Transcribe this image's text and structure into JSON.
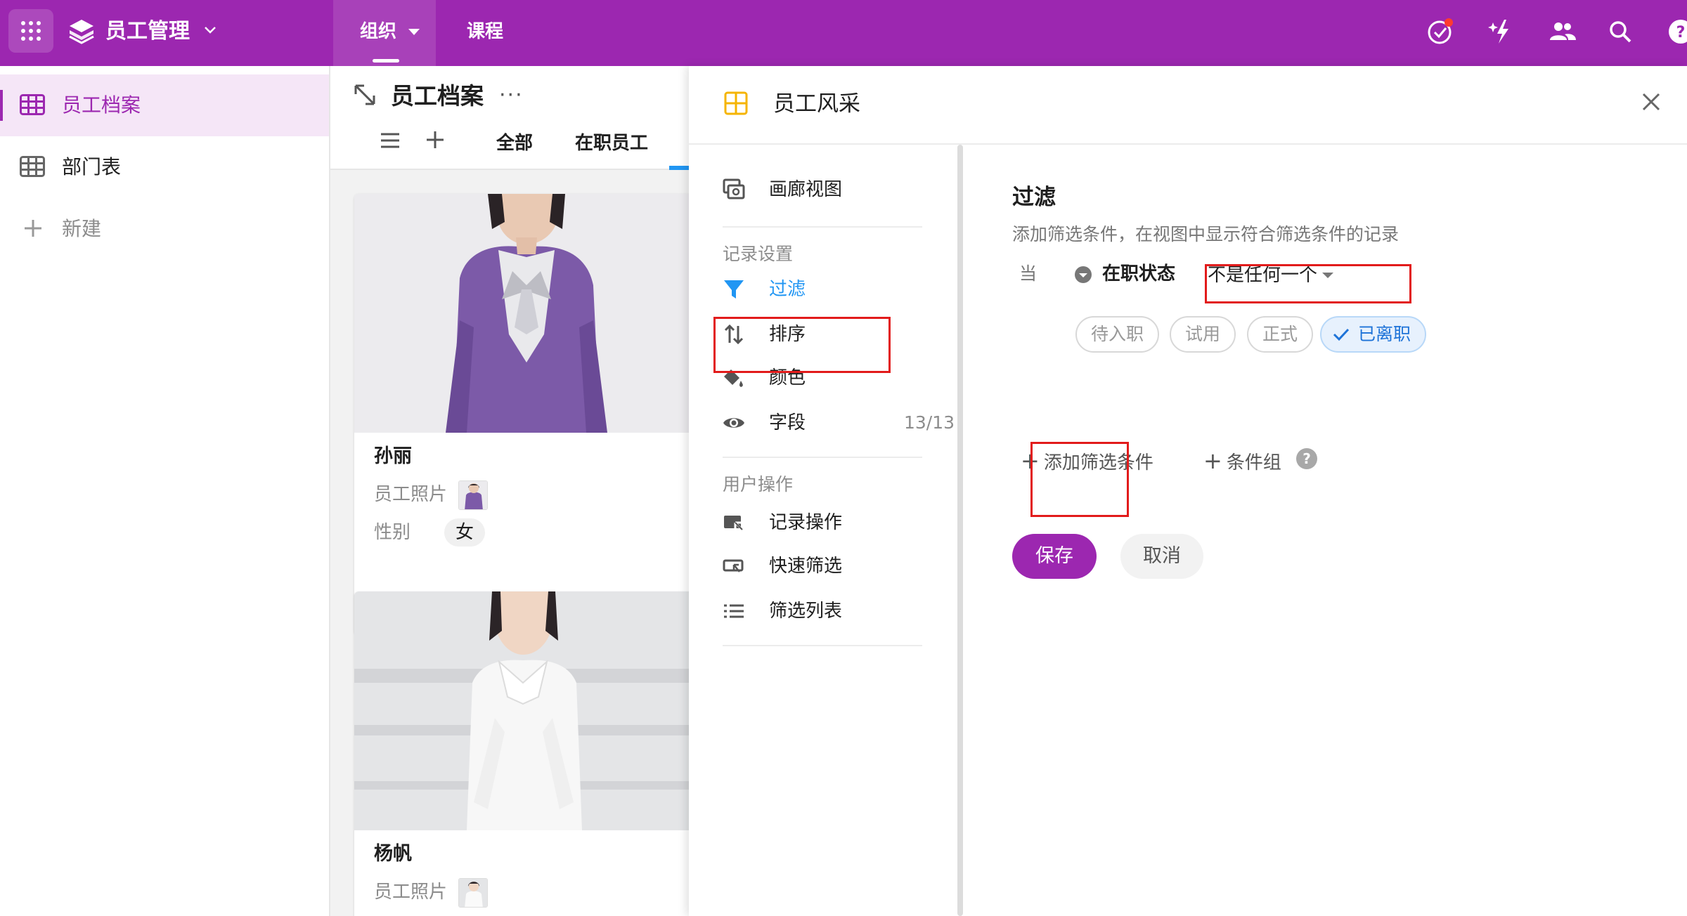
{
  "topbar": {
    "app_title": "员工管理",
    "nav_tabs": [
      {
        "label": "组织",
        "active": true
      },
      {
        "label": "课程",
        "active": false
      }
    ],
    "icons": [
      "check-circle-icon",
      "sparkle-icon",
      "people-icon",
      "search-icon",
      "help-icon"
    ]
  },
  "sidebar": {
    "items": [
      {
        "label": "员工档案",
        "icon": "table-icon",
        "active": true
      },
      {
        "label": "部门表",
        "icon": "table-icon",
        "active": false
      },
      {
        "label": "新建",
        "icon": "plus-icon",
        "active": false
      }
    ]
  },
  "main": {
    "title": "员工档案",
    "more": "···",
    "view_tabs": [
      "全部",
      "在职员工"
    ],
    "cards": [
      {
        "name": "孙丽",
        "photo_label": "员工照片",
        "gender_label": "性别",
        "gender": "女"
      },
      {
        "name": "杨帆",
        "photo_label": "员工照片"
      }
    ]
  },
  "panel": {
    "title": "员工风采",
    "menu": {
      "gallery_view": "画廊视图",
      "record_settings": "记录设置",
      "filter": "过滤",
      "sort": "排序",
      "color": "颜色",
      "fields": "字段",
      "fields_count": "13/13",
      "user_actions": "用户操作",
      "record_actions": "记录操作",
      "quick_filter": "快速筛选",
      "filter_list": "筛选列表"
    },
    "filter": {
      "title": "过滤",
      "description": "添加筛选条件，在视图中显示符合筛选条件的记录",
      "when": "当",
      "field": "在职状态",
      "operator": "不是任何一个",
      "options": [
        {
          "label": "待入职",
          "selected": false
        },
        {
          "label": "试用",
          "selected": false
        },
        {
          "label": "正式",
          "selected": false
        },
        {
          "label": "已离职",
          "selected": true
        }
      ],
      "add_condition": "添加筛选条件",
      "condition_group": "条件组",
      "help": "?",
      "save": "保存",
      "cancel": "取消"
    }
  },
  "colors": {
    "brand": "#9c27b0",
    "active_blue": "#2196f3",
    "highlight_red": "#e21b1b"
  }
}
